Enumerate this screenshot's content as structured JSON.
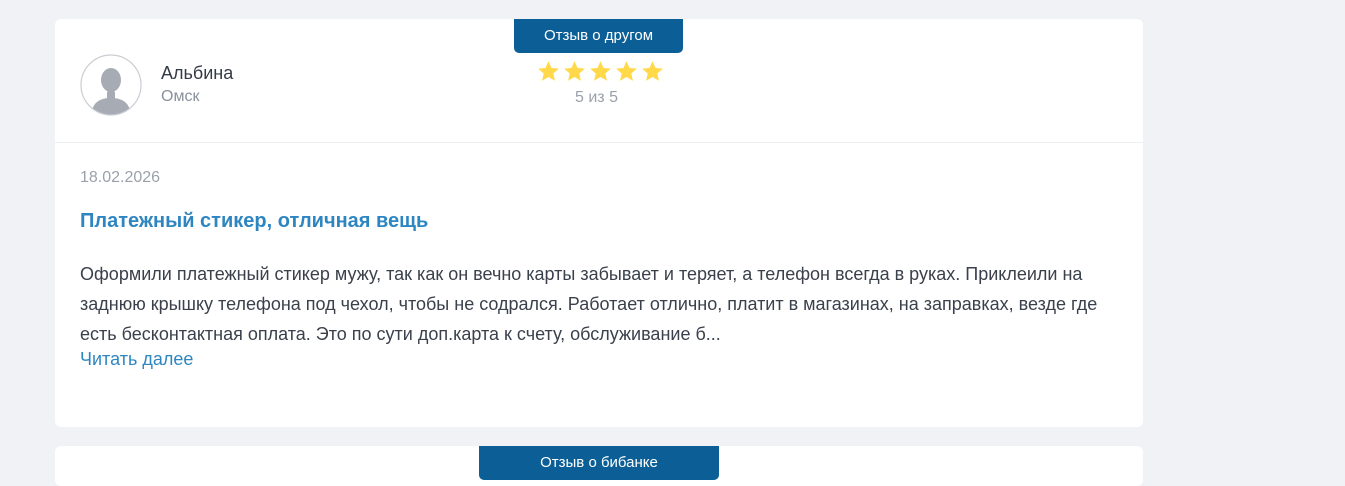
{
  "reviews": [
    {
      "badge": "Отзыв о другом",
      "author": "Альбина",
      "city": "Омск",
      "rating": 5,
      "rating_text": "5 из 5",
      "date": "18.02.2026",
      "title": "Платежный стикер, отличная вещь",
      "text": "Оформили платежный стикер мужу, так как он вечно карты забывает и теряет, а телефон всегда в руках. Приклеили на заднюю крышку телефона под чехол, чтобы не содрался. Работает отлично, платит в магазинах, на заправках, везде где есть бесконтактная оплата. Это по сути доп.карта к счету, обслуживание б...",
      "read_more": "Читать далее"
    },
    {
      "badge": "Отзыв о бибанке"
    }
  ],
  "colors": {
    "badge": "#0b5f96",
    "title": "#2e86c1",
    "star": "#ffd94a",
    "background": "#f0f2f5"
  },
  "icons": {
    "avatar": "user-avatar-icon",
    "star": "star-icon"
  }
}
